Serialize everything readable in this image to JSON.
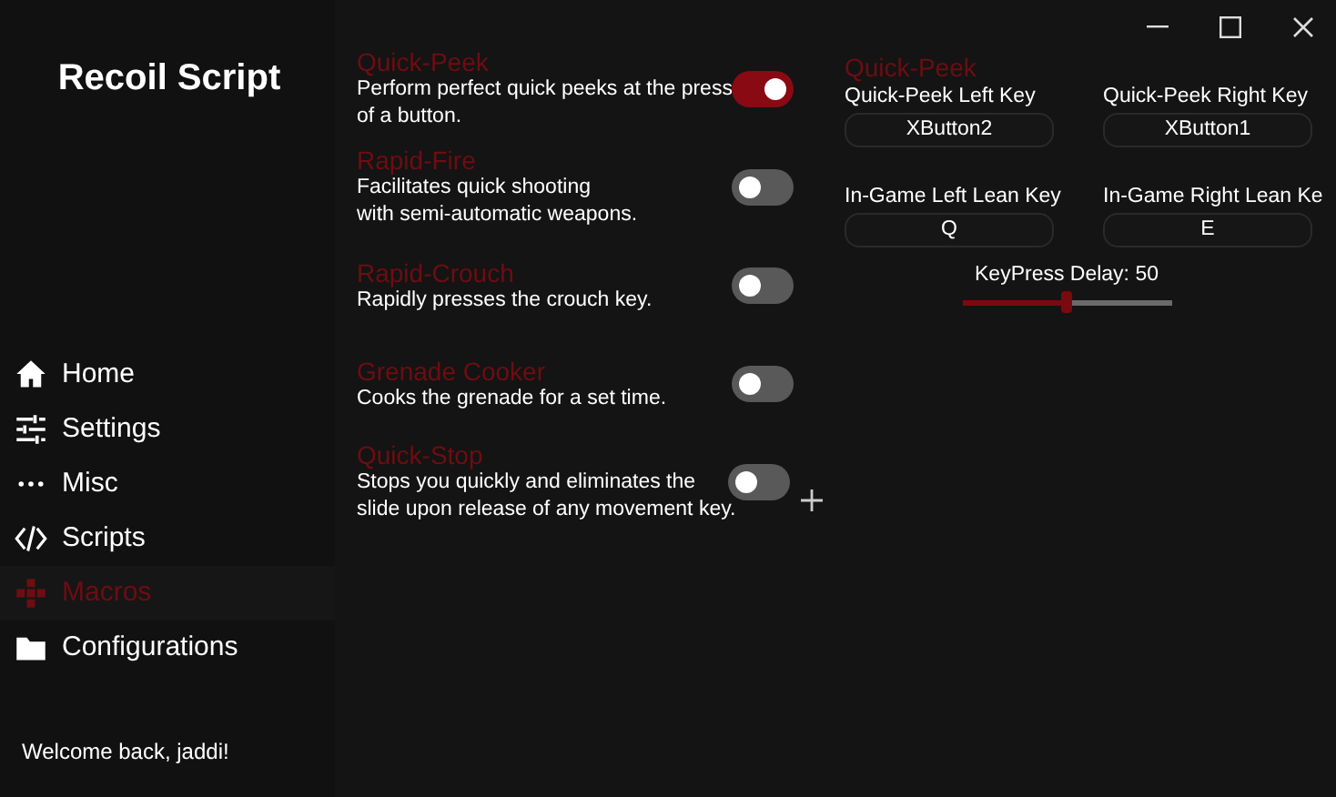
{
  "app": {
    "title": "Recoil Script"
  },
  "nav": [
    {
      "label": "Home",
      "selected": false
    },
    {
      "label": "Settings",
      "selected": false
    },
    {
      "label": "Misc",
      "selected": false
    },
    {
      "label": "Scripts",
      "selected": false
    },
    {
      "label": "Macros",
      "selected": true
    },
    {
      "label": "Configurations",
      "selected": false
    }
  ],
  "welcome": "Welcome back, jaddi!",
  "macros": [
    {
      "title": "Quick-Peek",
      "description": "Perform perfect quick peeks at the press of a button.",
      "on": true
    },
    {
      "title": "Rapid-Fire",
      "description": "Facilitates quick shooting\nwith semi-automatic weapons.",
      "on": false
    },
    {
      "title": "Rapid-Crouch",
      "description": "Rapidly presses the crouch key.",
      "on": false
    },
    {
      "title": "Grenade Cooker",
      "description": "Cooks the grenade for a set time.",
      "on": false
    },
    {
      "title": "Quick-Stop",
      "description": "Stops you quickly and eliminates the\nslide upon release of any movement key.",
      "on": false
    }
  ],
  "settings": {
    "title": "Quick-Peek",
    "keys": [
      {
        "label": "Quick-Peek Left Key",
        "value": "XButton2"
      },
      {
        "label": "Quick-Peek Right Key",
        "value": "XButton1"
      },
      {
        "label": "In-Game Left Lean Key",
        "value": "Q"
      },
      {
        "label": "In-Game Right Lean Ke",
        "value": "E"
      }
    ],
    "delay": {
      "label": "KeyPress Delay: 50",
      "level": 0.5
    }
  }
}
